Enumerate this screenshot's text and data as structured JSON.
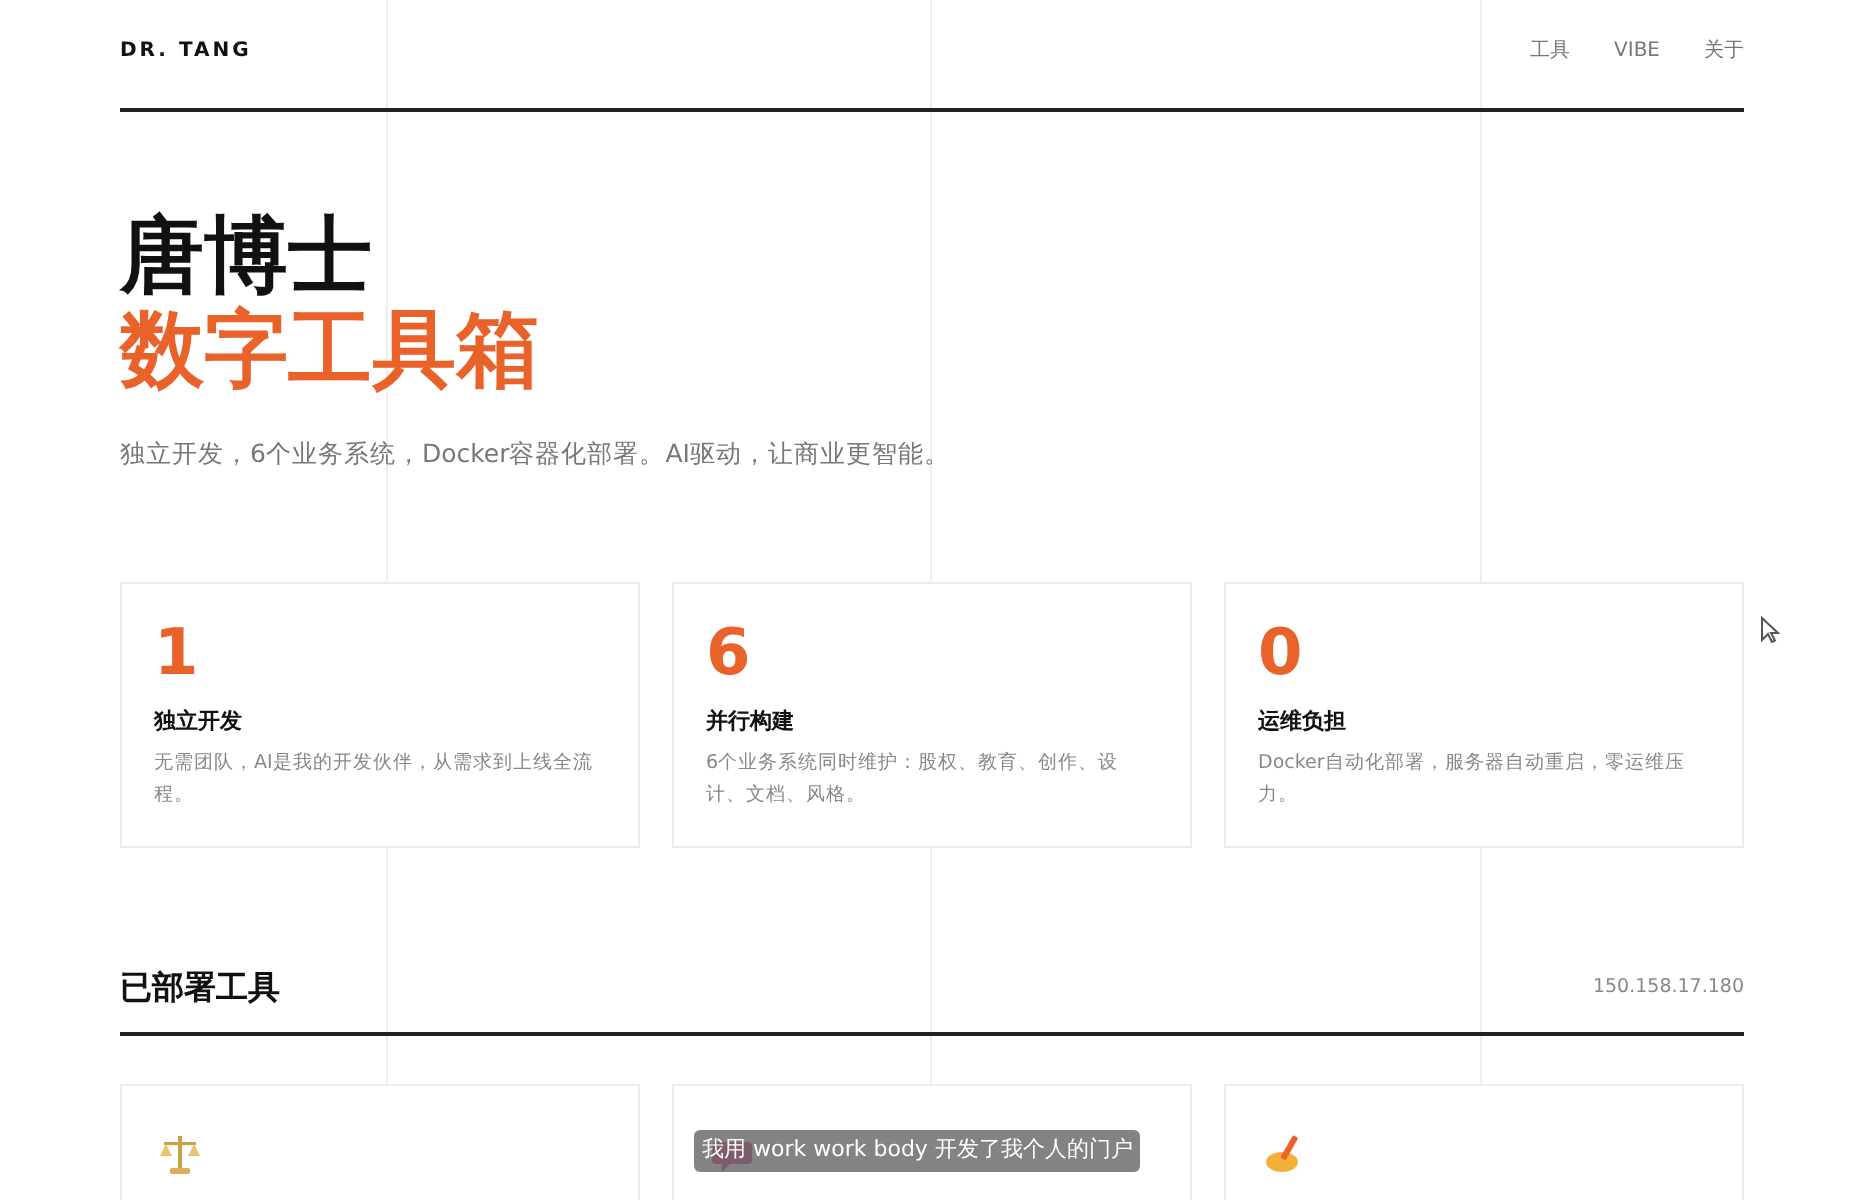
{
  "brand": "DR. TANG",
  "nav": [
    {
      "label": "工具"
    },
    {
      "label": "VIBE"
    },
    {
      "label": "关于"
    }
  ],
  "hero": {
    "title": "唐博士",
    "highlight": "数字工具箱",
    "tagline": "独立开发，6个业务系统，Docker容器化部署。AI驱动，让商业更智能。"
  },
  "stats": [
    {
      "value": "1",
      "title": "独立开发",
      "desc": "无需团队，AI是我的开发伙伴，从需求到上线全流程。"
    },
    {
      "value": "6",
      "title": "并行构建",
      "desc": "6个业务系统同时维护：股权、教育、创作、设计、文档、风格。"
    },
    {
      "value": "0",
      "title": "运维负担",
      "desc": "Docker自动化部署，服务器自动重启，零运维压力。"
    }
  ],
  "section": {
    "title": "已部署工具",
    "address": "150.158.17.180"
  },
  "tools": [
    {
      "kind": "scales"
    },
    {
      "kind": "chat"
    },
    {
      "kind": "pen"
    }
  ],
  "caption": "我用 work work body 开发了我个人的门户"
}
